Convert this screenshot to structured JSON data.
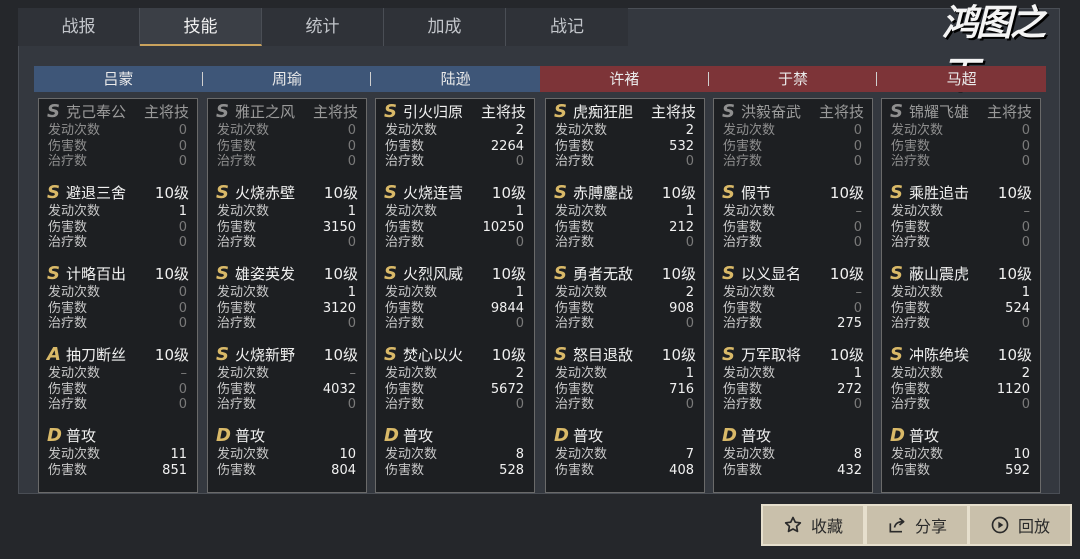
{
  "tabs": [
    "战报",
    "技能",
    "统计",
    "加成",
    "战记"
  ],
  "active_tab": 1,
  "logo_text": "鸿图之下",
  "generals": [
    {
      "name": "吕蒙",
      "side": "blue",
      "skills": [
        {
          "grade": "S",
          "name": "克己奉公",
          "level": "主将技",
          "dim": true,
          "stats": [
            {
              "label": "发动次数",
              "value": "0",
              "dim": true
            },
            {
              "label": "伤害数",
              "value": "0",
              "dim": true
            },
            {
              "label": "治疗数",
              "value": "0",
              "dim": true
            }
          ]
        },
        {
          "grade": "S",
          "name": "避退三舍",
          "level": "10级",
          "dim": false,
          "stats": [
            {
              "label": "发动次数",
              "value": "1"
            },
            {
              "label": "伤害数",
              "value": "0",
              "dim": true
            },
            {
              "label": "治疗数",
              "value": "0",
              "dim": true
            }
          ]
        },
        {
          "grade": "S",
          "name": "计略百出",
          "level": "10级",
          "dim": false,
          "stats": [
            {
              "label": "发动次数",
              "value": "0",
              "dim": true
            },
            {
              "label": "伤害数",
              "value": "0",
              "dim": true
            },
            {
              "label": "治疗数",
              "value": "0",
              "dim": true
            }
          ]
        },
        {
          "grade": "A",
          "name": "抽刀断丝",
          "level": "10级",
          "dim": false,
          "stats": [
            {
              "label": "发动次数",
              "value": "–",
              "dim": true
            },
            {
              "label": "伤害数",
              "value": "0",
              "dim": true
            },
            {
              "label": "治疗数",
              "value": "0",
              "dim": true
            }
          ]
        },
        {
          "grade": "D",
          "name": "普攻",
          "level": "",
          "dim": false,
          "stats": [
            {
              "label": "发动次数",
              "value": "11"
            },
            {
              "label": "伤害数",
              "value": "851"
            }
          ]
        }
      ]
    },
    {
      "name": "周瑜",
      "side": "blue",
      "skills": [
        {
          "grade": "S",
          "name": "雅正之风",
          "level": "主将技",
          "dim": true,
          "stats": [
            {
              "label": "发动次数",
              "value": "0",
              "dim": true
            },
            {
              "label": "伤害数",
              "value": "0",
              "dim": true
            },
            {
              "label": "治疗数",
              "value": "0",
              "dim": true
            }
          ]
        },
        {
          "grade": "S",
          "name": "火烧赤壁",
          "level": "10级",
          "dim": false,
          "stats": [
            {
              "label": "发动次数",
              "value": "1"
            },
            {
              "label": "伤害数",
              "value": "3150"
            },
            {
              "label": "治疗数",
              "value": "0",
              "dim": true
            }
          ]
        },
        {
          "grade": "S",
          "name": "雄姿英发",
          "level": "10级",
          "dim": false,
          "stats": [
            {
              "label": "发动次数",
              "value": "1"
            },
            {
              "label": "伤害数",
              "value": "3120"
            },
            {
              "label": "治疗数",
              "value": "0",
              "dim": true
            }
          ]
        },
        {
          "grade": "S",
          "name": "火烧新野",
          "level": "10级",
          "dim": false,
          "stats": [
            {
              "label": "发动次数",
              "value": "–",
              "dim": true
            },
            {
              "label": "伤害数",
              "value": "4032"
            },
            {
              "label": "治疗数",
              "value": "0",
              "dim": true
            }
          ]
        },
        {
          "grade": "D",
          "name": "普攻",
          "level": "",
          "dim": false,
          "stats": [
            {
              "label": "发动次数",
              "value": "10"
            },
            {
              "label": "伤害数",
              "value": "804"
            }
          ]
        }
      ]
    },
    {
      "name": "陆逊",
      "side": "blue",
      "skills": [
        {
          "grade": "S",
          "name": "引火归原",
          "level": "主将技",
          "dim": false,
          "stats": [
            {
              "label": "发动次数",
              "value": "2"
            },
            {
              "label": "伤害数",
              "value": "2264"
            },
            {
              "label": "治疗数",
              "value": "0",
              "dim": true
            }
          ]
        },
        {
          "grade": "S",
          "name": "火烧连营",
          "level": "10级",
          "dim": false,
          "stats": [
            {
              "label": "发动次数",
              "value": "1"
            },
            {
              "label": "伤害数",
              "value": "10250"
            },
            {
              "label": "治疗数",
              "value": "0",
              "dim": true
            }
          ]
        },
        {
          "grade": "S",
          "name": "火烈风威",
          "level": "10级",
          "dim": false,
          "stats": [
            {
              "label": "发动次数",
              "value": "1"
            },
            {
              "label": "伤害数",
              "value": "9844"
            },
            {
              "label": "治疗数",
              "value": "0",
              "dim": true
            }
          ]
        },
        {
          "grade": "S",
          "name": "焚心以火",
          "level": "10级",
          "dim": false,
          "stats": [
            {
              "label": "发动次数",
              "value": "2"
            },
            {
              "label": "伤害数",
              "value": "5672"
            },
            {
              "label": "治疗数",
              "value": "0",
              "dim": true
            }
          ]
        },
        {
          "grade": "D",
          "name": "普攻",
          "level": "",
          "dim": false,
          "stats": [
            {
              "label": "发动次数",
              "value": "8"
            },
            {
              "label": "伤害数",
              "value": "528"
            }
          ]
        }
      ]
    },
    {
      "name": "许褚",
      "side": "red",
      "skills": [
        {
          "grade": "S",
          "name": "虎痴狂胆",
          "level": "主将技",
          "dim": false,
          "stats": [
            {
              "label": "发动次数",
              "value": "2"
            },
            {
              "label": "伤害数",
              "value": "532"
            },
            {
              "label": "治疗数",
              "value": "0",
              "dim": true
            }
          ]
        },
        {
          "grade": "S",
          "name": "赤膊鏖战",
          "level": "10级",
          "dim": false,
          "stats": [
            {
              "label": "发动次数",
              "value": "1"
            },
            {
              "label": "伤害数",
              "value": "212"
            },
            {
              "label": "治疗数",
              "value": "0",
              "dim": true
            }
          ]
        },
        {
          "grade": "S",
          "name": "勇者无敌",
          "level": "10级",
          "dim": false,
          "stats": [
            {
              "label": "发动次数",
              "value": "2"
            },
            {
              "label": "伤害数",
              "value": "908"
            },
            {
              "label": "治疗数",
              "value": "0",
              "dim": true
            }
          ]
        },
        {
          "grade": "S",
          "name": "怒目退敌",
          "level": "10级",
          "dim": false,
          "stats": [
            {
              "label": "发动次数",
              "value": "1"
            },
            {
              "label": "伤害数",
              "value": "716"
            },
            {
              "label": "治疗数",
              "value": "0",
              "dim": true
            }
          ]
        },
        {
          "grade": "D",
          "name": "普攻",
          "level": "",
          "dim": false,
          "stats": [
            {
              "label": "发动次数",
              "value": "7"
            },
            {
              "label": "伤害数",
              "value": "408"
            }
          ]
        }
      ]
    },
    {
      "name": "于禁",
      "side": "red",
      "skills": [
        {
          "grade": "S",
          "name": "洪毅奋武",
          "level": "主将技",
          "dim": true,
          "stats": [
            {
              "label": "发动次数",
              "value": "0",
              "dim": true
            },
            {
              "label": "伤害数",
              "value": "0",
              "dim": true
            },
            {
              "label": "治疗数",
              "value": "0",
              "dim": true
            }
          ]
        },
        {
          "grade": "S",
          "name": "假节",
          "level": "10级",
          "dim": false,
          "stats": [
            {
              "label": "发动次数",
              "value": "–",
              "dim": true
            },
            {
              "label": "伤害数",
              "value": "0",
              "dim": true
            },
            {
              "label": "治疗数",
              "value": "0",
              "dim": true
            }
          ]
        },
        {
          "grade": "S",
          "name": "以义显名",
          "level": "10级",
          "dim": false,
          "stats": [
            {
              "label": "发动次数",
              "value": "–",
              "dim": true
            },
            {
              "label": "伤害数",
              "value": "0",
              "dim": true
            },
            {
              "label": "治疗数",
              "value": "275"
            }
          ]
        },
        {
          "grade": "S",
          "name": "万军取将",
          "level": "10级",
          "dim": false,
          "stats": [
            {
              "label": "发动次数",
              "value": "1"
            },
            {
              "label": "伤害数",
              "value": "272"
            },
            {
              "label": "治疗数",
              "value": "0",
              "dim": true
            }
          ]
        },
        {
          "grade": "D",
          "name": "普攻",
          "level": "",
          "dim": false,
          "stats": [
            {
              "label": "发动次数",
              "value": "8"
            },
            {
              "label": "伤害数",
              "value": "432"
            }
          ]
        }
      ]
    },
    {
      "name": "马超",
      "side": "red",
      "skills": [
        {
          "grade": "S",
          "name": "锦耀飞雄",
          "level": "主将技",
          "dim": true,
          "stats": [
            {
              "label": "发动次数",
              "value": "0",
              "dim": true
            },
            {
              "label": "伤害数",
              "value": "0",
              "dim": true
            },
            {
              "label": "治疗数",
              "value": "0",
              "dim": true
            }
          ]
        },
        {
          "grade": "S",
          "name": "乘胜追击",
          "level": "10级",
          "dim": false,
          "stats": [
            {
              "label": "发动次数",
              "value": "–",
              "dim": true
            },
            {
              "label": "伤害数",
              "value": "0",
              "dim": true
            },
            {
              "label": "治疗数",
              "value": "0",
              "dim": true
            }
          ]
        },
        {
          "grade": "S",
          "name": "蔽山震虎",
          "level": "10级",
          "dim": false,
          "stats": [
            {
              "label": "发动次数",
              "value": "1"
            },
            {
              "label": "伤害数",
              "value": "524"
            },
            {
              "label": "治疗数",
              "value": "0",
              "dim": true
            }
          ]
        },
        {
          "grade": "S",
          "name": "冲陈绝埃",
          "level": "10级",
          "dim": false,
          "stats": [
            {
              "label": "发动次数",
              "value": "2"
            },
            {
              "label": "伤害数",
              "value": "1120"
            },
            {
              "label": "治疗数",
              "value": "0",
              "dim": true
            }
          ]
        },
        {
          "grade": "D",
          "name": "普攻",
          "level": "",
          "dim": false,
          "stats": [
            {
              "label": "发动次数",
              "value": "10"
            },
            {
              "label": "伤害数",
              "value": "592"
            }
          ]
        }
      ]
    }
  ],
  "buttons": [
    {
      "label": "收藏",
      "icon": "star-icon"
    },
    {
      "label": "分享",
      "icon": "share-icon"
    },
    {
      "label": "回放",
      "icon": "play-icon"
    }
  ]
}
